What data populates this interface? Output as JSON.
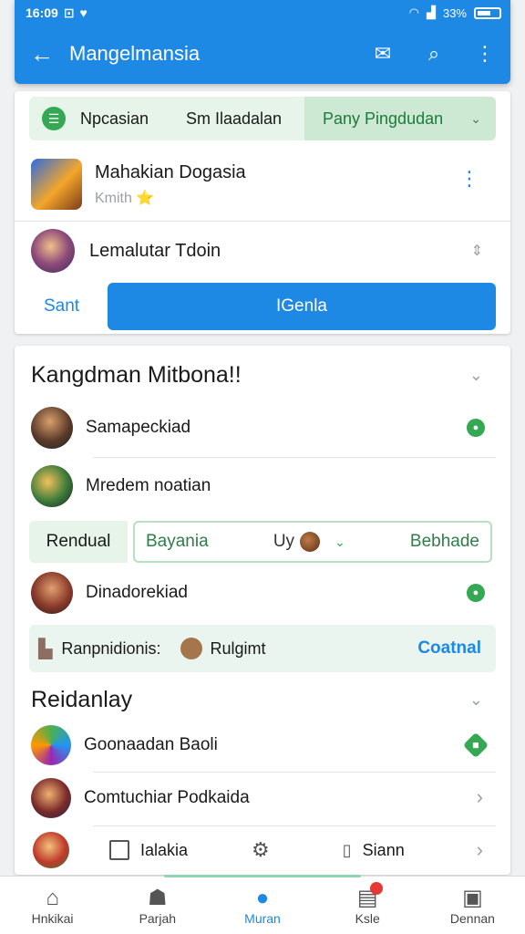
{
  "status": {
    "time": "16:09",
    "battery": "33%"
  },
  "appbar": {
    "title": "Mangelmansia"
  },
  "card1": {
    "filter": {
      "tab1": "Npcasian",
      "tab2": "Sm Ilaadalan",
      "tab3": "Pany Pingdudan"
    },
    "item1": {
      "title": "Mahakian Dogasia",
      "subtitle": "Kmith ⭐"
    },
    "item2": {
      "title": "Lemalutar Tdoin"
    },
    "buttons": {
      "secondary": "Sant",
      "primary": "IGenla"
    }
  },
  "section1": {
    "title": "Kangdman Mitbona!!",
    "rows": [
      {
        "label": "Samapeckiad"
      },
      {
        "label": "Mredem noatian"
      }
    ],
    "segment": {
      "left": "Rendual",
      "field": "Bayania",
      "mid": "Uy",
      "right": "Bebhade"
    },
    "row3": {
      "label": "Dinadorekiad"
    },
    "info": {
      "label": "Ranpnidionis:",
      "coin_label": "Rulgimt",
      "link": "Coatnal"
    }
  },
  "section2": {
    "title": "Reidanlay",
    "rows": [
      {
        "label": "Goonaadan Baoli"
      },
      {
        "label": "Comtuchiar Podkaida"
      }
    ],
    "minirow": {
      "item1": "Ialakia",
      "item2": "Siann"
    }
  },
  "bottomnav": [
    {
      "label": "Hnkikai"
    },
    {
      "label": "Parjah"
    },
    {
      "label": "Muran"
    },
    {
      "label": "Ksle"
    },
    {
      "label": "Dennan"
    }
  ]
}
